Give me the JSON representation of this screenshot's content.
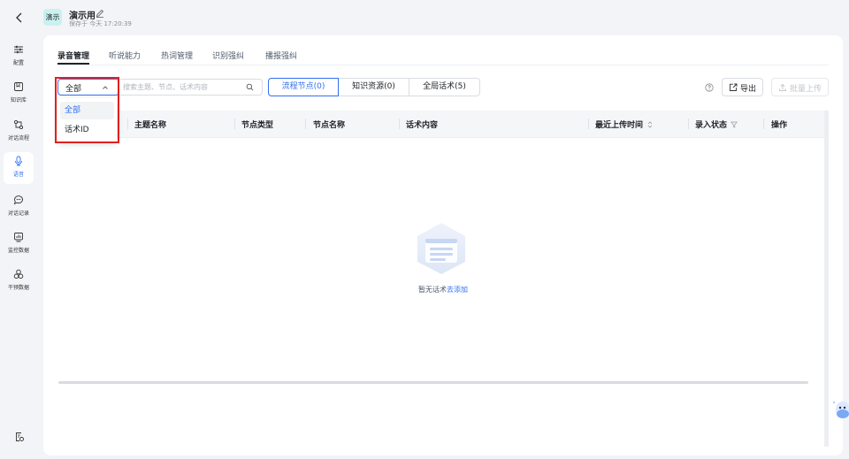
{
  "header": {
    "app_badge": "演示",
    "app_name": "演示用",
    "save_status": "保存于 今天 17:20:39"
  },
  "sidebar": {
    "items": [
      {
        "label": "配置",
        "icon": "sliders-icon"
      },
      {
        "label": "知识库",
        "icon": "book-icon"
      },
      {
        "label": "对话流程",
        "icon": "flow-icon"
      },
      {
        "label": "语音",
        "icon": "mic-icon",
        "active": true
      },
      {
        "label": "对话记录",
        "icon": "chat-icon"
      },
      {
        "label": "监控数据",
        "icon": "monitor-chart-icon"
      },
      {
        "label": "干预数据",
        "icon": "intervene-icon"
      }
    ]
  },
  "tabs": [
    "录音管理",
    "听说能力",
    "热词管理",
    "识别强纠",
    "播报强纠"
  ],
  "active_tab": "录音管理",
  "filter": {
    "select_value": "全部",
    "search_placeholder": "搜索主题、节点、话术内容",
    "segments": [
      "流程节点(0)",
      "知识资源(0)",
      "全局话术(5)"
    ],
    "active_segment": "流程节点(0)"
  },
  "actions": {
    "export_label": "导出",
    "bulk_upload_label": "批量上传"
  },
  "table": {
    "columns": [
      "主题名称",
      "节点类型",
      "节点名称",
      "话术内容",
      "最近上传时间",
      "录入状态",
      "操作"
    ]
  },
  "empty": {
    "text": "暂无话术",
    "link": "去添加"
  },
  "dropdown": {
    "options": [
      "全部",
      "话术ID"
    ],
    "selected": "全部"
  },
  "colors": {
    "accent": "#3070f0",
    "highlight": "#e02020",
    "badge_bg": "#c9f1ef"
  }
}
